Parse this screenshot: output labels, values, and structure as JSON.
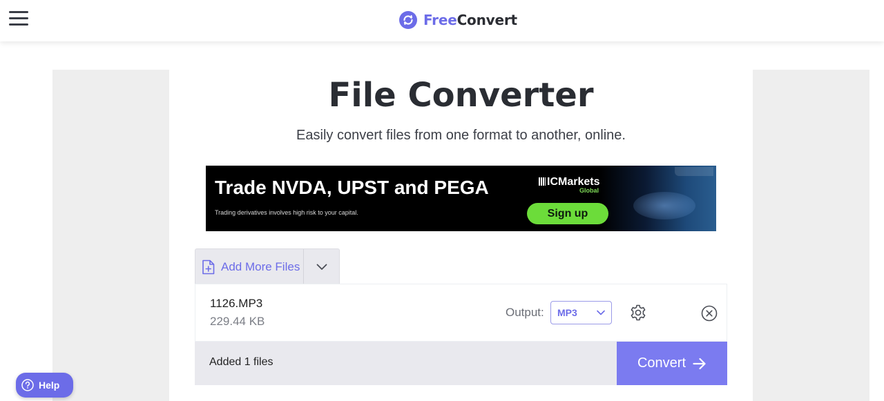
{
  "header": {
    "menu_icon": "hamburger-menu-icon",
    "brand_icon": "refresh-circle-icon",
    "brand_part1": "Free",
    "brand_part2": "Convert"
  },
  "main": {
    "title": "File Converter",
    "subtitle": "Easily convert files from one format to another, online."
  },
  "ad": {
    "headline": "Trade NVDA, UPST and PEGA",
    "disclaimer": "Trading derivatives involves high risk to your capital.",
    "logo_text": "ICMarkets",
    "logo_sub": "Global",
    "cta": "Sign up"
  },
  "upload": {
    "add_more_label": "Add More Files",
    "add_icon": "file-plus-icon",
    "caret_icon": "chevron-down-icon"
  },
  "file": {
    "name": "1126.MP3",
    "size": "229.44 KB",
    "output_label": "Output:",
    "output_value": "MP3",
    "settings_icon": "gear-icon",
    "remove_icon": "close-circle-icon"
  },
  "footer": {
    "added_text": "Added 1 files",
    "convert_label": "Convert",
    "convert_icon": "arrow-right-icon"
  },
  "help": {
    "label": "Help",
    "icon": "question-circle-icon"
  },
  "colors": {
    "accent": "#6c6ce8",
    "convert_button": "#7b7bf0",
    "ad_cta": "#6cdc3a",
    "panel_gray": "#e9e9ee"
  }
}
